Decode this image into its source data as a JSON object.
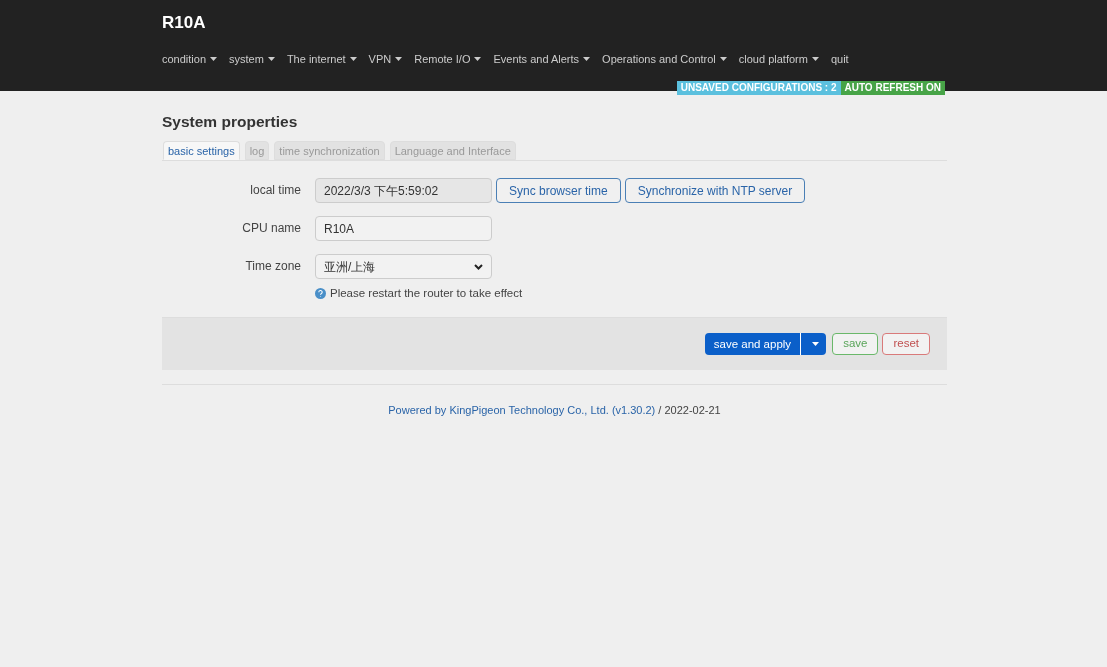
{
  "brand": "R10A",
  "nav": [
    {
      "label": "condition",
      "dropdown": true
    },
    {
      "label": "system",
      "dropdown": true
    },
    {
      "label": "The internet",
      "dropdown": true
    },
    {
      "label": "VPN",
      "dropdown": true
    },
    {
      "label": "Remote I/O",
      "dropdown": true
    },
    {
      "label": "Events and Alerts",
      "dropdown": true
    },
    {
      "label": "Operations and Control",
      "dropdown": true
    },
    {
      "label": "cloud platform",
      "dropdown": true
    },
    {
      "label": "quit",
      "dropdown": false
    }
  ],
  "badges": [
    {
      "text": "UNSAVED CONFIGURATIONS : 2",
      "color": "#5bc0de"
    },
    {
      "text": "AUTO REFRESH ON",
      "color": "#47a447"
    }
  ],
  "title": "System properties",
  "tabs": [
    {
      "label": "basic settings",
      "selected": true
    },
    {
      "label": "log",
      "selected": false
    },
    {
      "label": "time synchronization",
      "selected": false
    },
    {
      "label": "Language and Interface",
      "selected": false
    }
  ],
  "fields": [
    {
      "kind": "readonly",
      "label": "local time",
      "value": "2022/3/3 下午5:59:02",
      "buttons": [
        "Sync browser time",
        "Synchronize with NTP server"
      ]
    },
    {
      "kind": "text",
      "label": "CPU name",
      "value": "R10A"
    },
    {
      "kind": "select",
      "label": "Time zone",
      "value": "亚洲/上海",
      "hint": "Please restart the router to take effect"
    }
  ],
  "actions": {
    "apply": "save and apply",
    "save": "save",
    "reset": "reset"
  },
  "footer": {
    "link": "Powered by KingPigeon Technology Co., Ltd. (v1.30.2)",
    "date": " / 2022-02-21"
  }
}
